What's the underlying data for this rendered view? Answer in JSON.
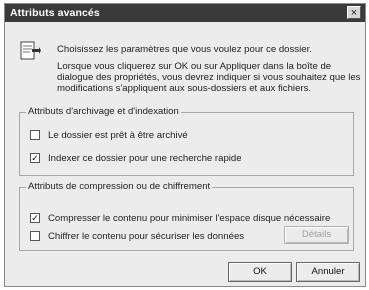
{
  "window": {
    "title": "Attributs avancés",
    "close_glyph": "×"
  },
  "intro": {
    "line1": "Choisissez les paramètres que vous voulez pour ce dossier.",
    "line2": "Lorsque vous cliquerez sur OK ou sur Appliquer dans la boîte de dialogue des propriétés, vous devrez indiquer si vous souhaitez que les modifications s'appliquent aux sous-dossiers et aux fichiers."
  },
  "archive_group": {
    "legend": "Attributs d'archivage et d'indexation",
    "options": [
      {
        "label": "Le dossier est prêt à être archivé",
        "checked": false
      },
      {
        "label": "Indexer ce dossier pour une recherche rapide",
        "checked": true
      }
    ]
  },
  "compress_group": {
    "legend": "Attributs de compression ou de chiffrement",
    "options": [
      {
        "label": "Compresser le contenu pour minimiser l'espace disque nécessaire",
        "checked": true
      },
      {
        "label": "Chiffrer le contenu pour sécuriser les données",
        "checked": false
      }
    ],
    "details_label": "Détails"
  },
  "buttons": {
    "ok": "OK",
    "cancel": "Annuler"
  },
  "icons": {
    "header": "folder-properties-icon",
    "check": "check-mark-icon"
  },
  "check_glyph": "✓"
}
